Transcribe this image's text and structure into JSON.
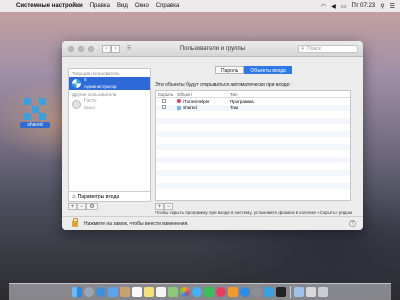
{
  "menubar": {
    "app_name": "Системные настройки",
    "menus": [
      "Правка",
      "Вид",
      "Окно",
      "Справка"
    ],
    "clock": "Пт 07:23"
  },
  "desktop": {
    "icon_label": "shared"
  },
  "window": {
    "title": "Пользователи и группы",
    "search_placeholder": "Поиск",
    "sidebar": {
      "current_user_header": "Текущий пользователь",
      "current_user": {
        "name": "s",
        "role": "Администратор"
      },
      "other_users_header": "Другие пользователи",
      "guest": {
        "name": "Гость",
        "role": "Выкл."
      },
      "login_options": "Параметры входа"
    },
    "tabs": [
      {
        "label": "Пароль",
        "active": false
      },
      {
        "label": "Объекты входа",
        "active": true
      }
    ],
    "login_items_heading": "Эти объекты будут открываться автоматически при входе:",
    "columns": {
      "hide": "Скрыть",
      "item": "Объект",
      "type": "Тип"
    },
    "rows": [
      {
        "name": "iTunesHelper",
        "kind": "Программа",
        "icon": "itunes-icon"
      },
      {
        "name": "shared",
        "kind": "Том",
        "icon": "folder-icon"
      }
    ],
    "hint": "Чтобы скрыть программу при входе в систему, установите флажок в колонке «Скрыть» рядом с программой.",
    "lock_text": "Нажмите на замок, чтобы внести изменения."
  },
  "colors": {
    "selection": "#2d6ad8",
    "tab_active": "#2f78e6"
  }
}
